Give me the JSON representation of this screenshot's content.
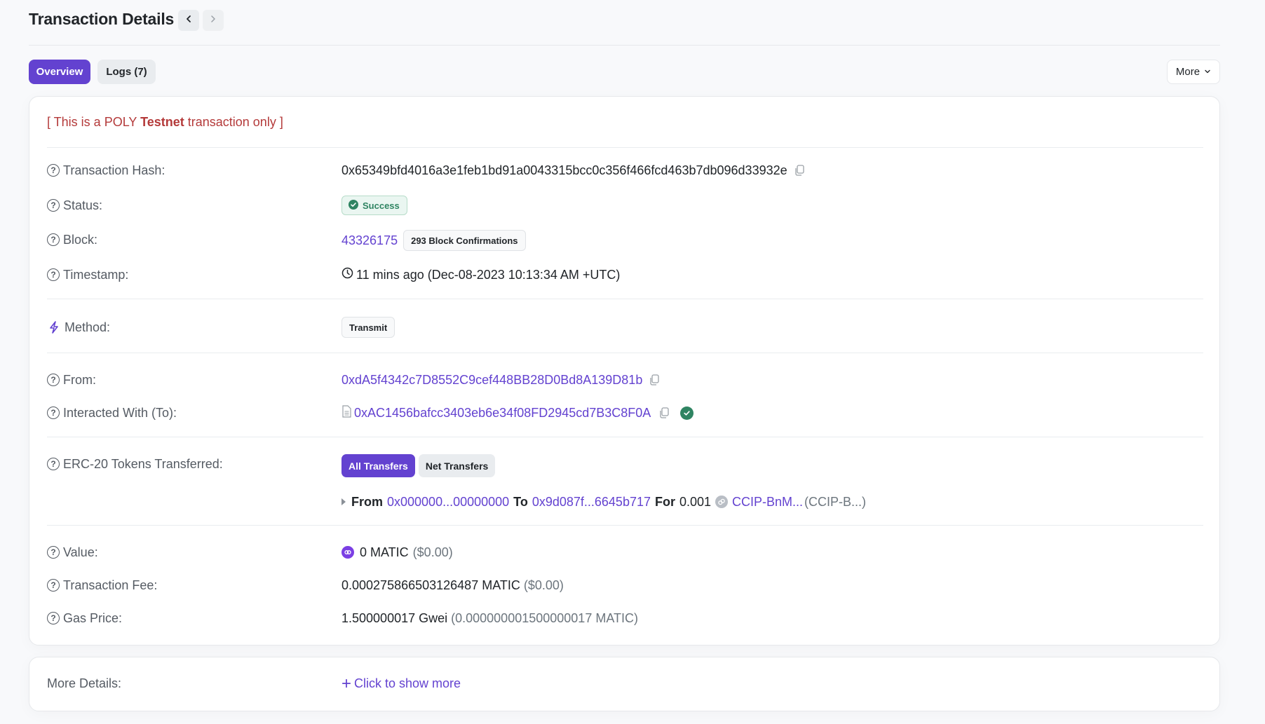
{
  "header": {
    "title": "Transaction Details",
    "prev_icon": "chevron-left-icon",
    "next_icon": "chevron-right-icon"
  },
  "tabs": [
    {
      "label": "Overview",
      "active": true
    },
    {
      "label": "Logs (7)",
      "active": false
    }
  ],
  "more_menu": {
    "label": "More",
    "icon": "chevron-down-icon"
  },
  "notice": {
    "prefix": "[ This is a POLY ",
    "bold": "Testnet",
    "suffix": " transaction only ]"
  },
  "rows": {
    "tx_hash": {
      "label": "Transaction Hash:",
      "value": "0x65349bfd4016a3e1feb1bd91a0043315bcc0c356f466fcd463b7db096d33932e"
    },
    "status": {
      "label": "Status:",
      "value": "Success",
      "color": "#2f8462"
    },
    "block": {
      "label": "Block:",
      "value": "43326175",
      "confirmations": "293 Block Confirmations"
    },
    "timestamp": {
      "label": "Timestamp:",
      "value": "11 mins ago (Dec-08-2023 10:13:34 AM +UTC)"
    },
    "method": {
      "label": "Method:",
      "value": "Transmit"
    },
    "from": {
      "label": "From:",
      "value": "0xdA5f4342c7D8552C9cef448BB28D0Bd8A139D81b"
    },
    "to": {
      "label": "Interacted With (To):",
      "value": "0xAC1456bafcc3403eb6e34f08FD2945cd7B3C8F0A"
    },
    "erc20": {
      "label": "ERC-20 Tokens Transferred:",
      "filters": [
        {
          "label": "All Transfers",
          "active": true
        },
        {
          "label": "Net Transfers",
          "active": false
        }
      ],
      "transfer": {
        "from_word": "From",
        "from_addr": "0x000000...00000000",
        "to_word": "To",
        "to_addr": "0x9d087f...6645b717",
        "for_word": "For",
        "amount": "0.001",
        "token_name": "CCIP-BnM...",
        "token_symbol": "(CCIP-B...)"
      }
    },
    "value": {
      "label": "Value:",
      "amount": "0 MATIC",
      "usd": "($0.00)"
    },
    "fee": {
      "label": "Transaction Fee:",
      "amount": "0.000275866503126487 MATIC",
      "usd": "($0.00)"
    },
    "gas_price": {
      "label": "Gas Price:",
      "amount": "1.500000017 Gwei",
      "detail": "(0.000000001500000017 MATIC)"
    }
  },
  "more_details": {
    "label": "More Details:",
    "link": "Click to show more"
  },
  "colors": {
    "accent": "#6342d0",
    "testnet_red": "#b43a3a",
    "success": "#2f8462"
  }
}
